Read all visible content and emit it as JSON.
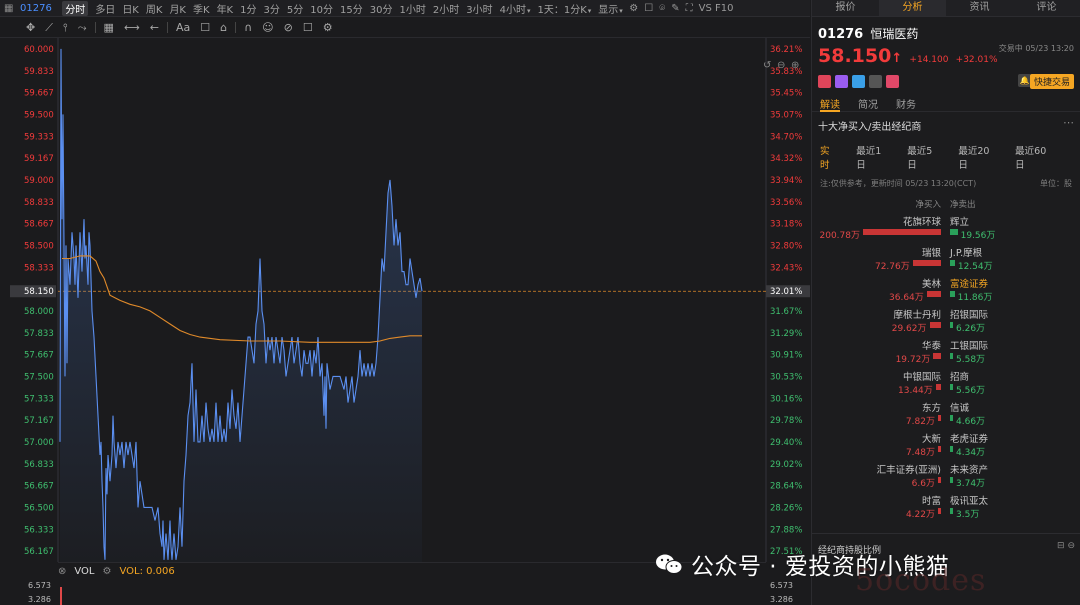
{
  "toolbar": {
    "code": "01276",
    "timeframes": [
      "分时",
      "多日",
      "日K",
      "周K",
      "月K",
      "季K",
      "年K",
      "1分",
      "3分",
      "5分",
      "10分",
      "15分",
      "30分",
      "1小时",
      "2小时",
      "3小时",
      "4小时",
      "1天：1分K",
      "显示"
    ],
    "active": "分时",
    "right_label": "VS F10"
  },
  "drawing_tools": [
    "✥",
    "⟋",
    "⫯",
    "⤳",
    "▦",
    "⟷",
    "←",
    "Aa",
    "☐",
    "⌂",
    "∩",
    "☺",
    "⊘",
    "☐",
    "⚙"
  ],
  "chart": {
    "price_ticks": [
      "60.000",
      "59.833",
      "59.667",
      "59.500",
      "59.333",
      "59.167",
      "59.000",
      "58.833",
      "58.667",
      "58.500",
      "58.333",
      "58.150",
      "58.000",
      "57.833",
      "57.667",
      "57.500",
      "57.333",
      "57.167",
      "57.000",
      "56.833",
      "56.667",
      "56.500",
      "56.333",
      "56.167"
    ],
    "pct_ticks": [
      "36.21%",
      "35.83%",
      "35.45%",
      "35.07%",
      "34.70%",
      "34.32%",
      "33.94%",
      "33.56%",
      "33.18%",
      "32.80%",
      "32.43%",
      "32.01%",
      "31.67%",
      "31.29%",
      "30.91%",
      "30.53%",
      "30.16%",
      "29.78%",
      "29.40%",
      "29.02%",
      "28.64%",
      "28.26%",
      "27.88%",
      "27.51%"
    ],
    "current_price_label": "58.150",
    "current_pct_label": "32.01%",
    "colors": {
      "price_line": "#5b8ff0",
      "avg_line": "#e08a2a",
      "up": "#f23b3b",
      "down": "#3fbf6f",
      "accent": "#f5a623"
    }
  },
  "volume": {
    "label": "VOL",
    "value_label": "VOL: 0.006",
    "ticks_top": "6.573",
    "ticks_mid": "3.286"
  },
  "right_panel": {
    "tabs": [
      "报价",
      "分析",
      "资讯",
      "评论"
    ],
    "active_tab": "分析",
    "stock_code": "01276",
    "stock_name": "恒瑞医药",
    "price": "58.150",
    "arrow": "↑",
    "change": "+14.100",
    "change_pct": "+32.01%",
    "trade_info": "交易中 05/23 13:20",
    "quick_trade": "快捷交易",
    "subtabs": [
      "解读",
      "简况",
      "财务"
    ],
    "active_subtab": "解读",
    "section_title": "十大净买入/卖出经纪商",
    "period_tabs": [
      "实时",
      "最近1日",
      "最近5日",
      "最近20日",
      "最近60日"
    ],
    "active_period": "实时",
    "note": "注:仅供参考，更新时间 05/23 13:20(CCT)",
    "unit": "单位：股",
    "col_buy": "净买入",
    "col_sell": "净卖出",
    "rows": [
      {
        "buy": "花旗环球",
        "buy_val": "200.78万",
        "buy_amt": 200.78,
        "sell": "辉立",
        "sell_val": "19.56万",
        "sell_amt": 19.56,
        "sell_hl": false
      },
      {
        "buy": "瑞银",
        "buy_val": "72.76万",
        "buy_amt": 72.76,
        "sell": "J.P.摩根",
        "sell_val": "12.54万",
        "sell_amt": 12.54,
        "sell_hl": false
      },
      {
        "buy": "美林",
        "buy_val": "36.64万",
        "buy_amt": 36.64,
        "sell": "富途证券",
        "sell_val": "11.86万",
        "sell_amt": 11.86,
        "sell_hl": true
      },
      {
        "buy": "摩根士丹利",
        "buy_val": "29.62万",
        "buy_amt": 29.62,
        "sell": "招银国际",
        "sell_val": "6.26万",
        "sell_amt": 6.26,
        "sell_hl": false
      },
      {
        "buy": "华泰",
        "buy_val": "19.72万",
        "buy_amt": 19.72,
        "sell": "工银国际",
        "sell_val": "5.58万",
        "sell_amt": 5.58,
        "sell_hl": false
      },
      {
        "buy": "中银国际",
        "buy_val": "13.44万",
        "buy_amt": 13.44,
        "sell": "招商",
        "sell_val": "5.56万",
        "sell_amt": 5.56,
        "sell_hl": false
      },
      {
        "buy": "东方",
        "buy_val": "7.82万",
        "buy_amt": 7.82,
        "sell": "信诚",
        "sell_val": "4.66万",
        "sell_amt": 4.66,
        "sell_hl": false
      },
      {
        "buy": "大新",
        "buy_val": "7.48万",
        "buy_amt": 7.48,
        "sell": "老虎证券",
        "sell_val": "4.34万",
        "sell_amt": 4.34,
        "sell_hl": false
      },
      {
        "buy": "汇丰证券(亚洲)",
        "buy_val": "6.6万",
        "buy_amt": 6.6,
        "sell": "未来资产",
        "sell_val": "3.74万",
        "sell_amt": 3.74,
        "sell_hl": false
      },
      {
        "buy": "时富",
        "buy_val": "4.22万",
        "buy_amt": 4.22,
        "sell": "极讯亚太",
        "sell_val": "3.5万",
        "sell_amt": 3.5,
        "sell_hl": false
      }
    ],
    "footer": "经纪商持股比例"
  },
  "watermark": {
    "text": "公众号 · 爱投资的小熊猫",
    "faded": "5ocodes"
  }
}
